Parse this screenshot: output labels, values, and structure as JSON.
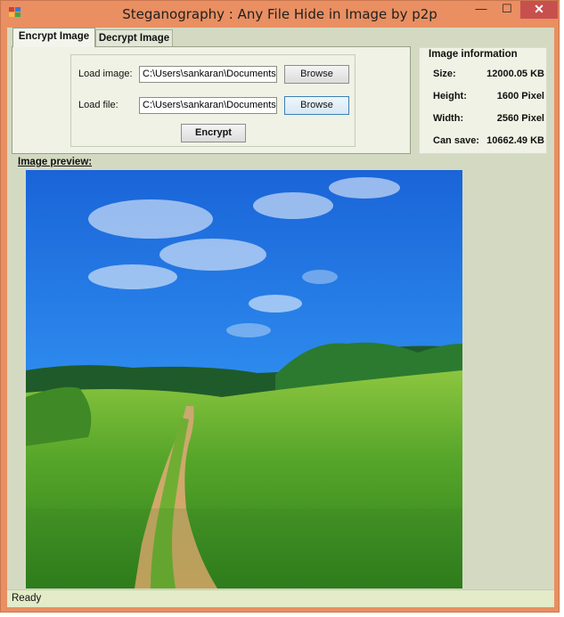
{
  "window": {
    "title": "Steganography : Any File Hide in Image by p2p",
    "minimize_glyph": "—",
    "maximize_glyph": "☐",
    "close_glyph": "✕",
    "icon": "app-icon"
  },
  "tabs": [
    {
      "label": "Encrypt Image",
      "selected": true
    },
    {
      "label": "Decrypt Image",
      "selected": false
    }
  ],
  "encrypt": {
    "load_image_label": "Load image:",
    "load_image_value": "C:\\Users\\sankaran\\Documents",
    "browse_image_label": "Browse",
    "load_file_label": "Load file:",
    "load_file_value": "C:\\Users\\sankaran\\Documents",
    "browse_file_label": "Browse",
    "encrypt_label": "Encrypt"
  },
  "image_info": {
    "title": "Image information",
    "rows": [
      {
        "label": "Size:",
        "value": "12000.05 KB"
      },
      {
        "label": "Height:",
        "value": "1600 Pixel"
      },
      {
        "label": "Width:",
        "value": "2560 Pixel"
      },
      {
        "label": "Can save:",
        "value": "10662.49 KB"
      }
    ]
  },
  "preview": {
    "label": "Image preview:"
  },
  "status": {
    "text": "Ready"
  },
  "colors": {
    "title_bar": "#e98f62",
    "client": "#d4dac2",
    "close_button": "#c7504f",
    "status_bar": "#e3ebc9"
  }
}
